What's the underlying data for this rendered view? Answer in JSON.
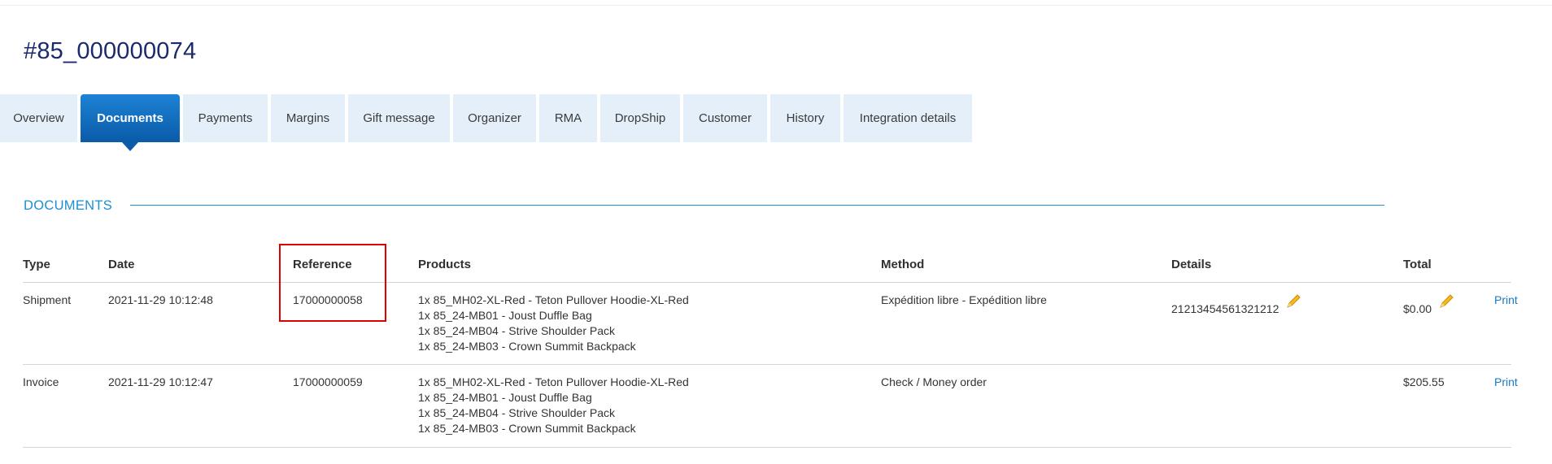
{
  "order": {
    "title": "#85_000000074"
  },
  "tabs": [
    {
      "label": "Overview"
    },
    {
      "label": "Documents"
    },
    {
      "label": "Payments"
    },
    {
      "label": "Margins"
    },
    {
      "label": "Gift message"
    },
    {
      "label": "Organizer"
    },
    {
      "label": "RMA"
    },
    {
      "label": "DropShip"
    },
    {
      "label": "Customer"
    },
    {
      "label": "History"
    },
    {
      "label": "Integration details"
    }
  ],
  "active_tab": "Documents",
  "section": {
    "title": "DOCUMENTS"
  },
  "table": {
    "headers": {
      "type": "Type",
      "date": "Date",
      "reference": "Reference",
      "products": "Products",
      "method": "Method",
      "details": "Details",
      "total": "Total"
    },
    "rows": [
      {
        "type": "Shipment",
        "date": "2021-11-29 10:12:48",
        "reference": "17000000058",
        "products": [
          "1x 85_MH02-XL-Red - Teton Pullover Hoodie-XL-Red",
          "1x 85_24-MB01 - Joust Duffle Bag",
          "1x 85_24-MB04 - Strive Shoulder Pack",
          "1x 85_24-MB03 - Crown Summit Backpack"
        ],
        "method": "Expédition libre - Expédition libre",
        "details": "21213454561321212",
        "total": "$0.00",
        "action": "Print"
      },
      {
        "type": "Invoice",
        "date": "2021-11-29 10:12:47",
        "reference": "17000000059",
        "products": [
          "1x 85_MH02-XL-Red - Teton Pullover Hoodie-XL-Red",
          "1x 85_24-MB01 - Joust Duffle Bag",
          "1x 85_24-MB04 - Strive Shoulder Pack",
          "1x 85_24-MB03 - Crown Summit Backpack"
        ],
        "method": "Check / Money order",
        "details": "",
        "total": "$205.55",
        "action": "Print"
      }
    ]
  },
  "icons": {
    "edit": "pencil-icon"
  },
  "colors": {
    "accent": "#1b8fd1",
    "tab_active": "#0a5ba8",
    "tab_bg": "#e4effa",
    "highlight": "#e00000",
    "title": "#1a2a6c"
  }
}
